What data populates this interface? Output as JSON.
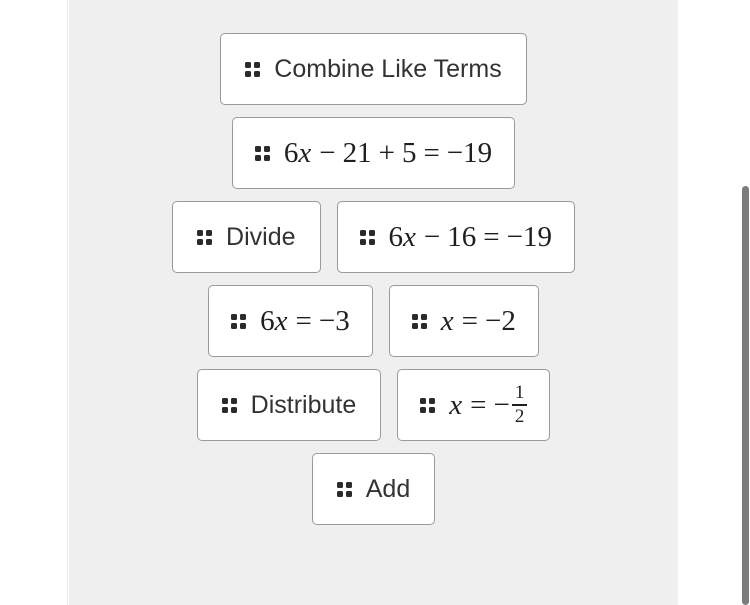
{
  "panel": {
    "background_color": "#efefef",
    "tile_background_color": "#ffffff",
    "tile_border_color": "#9a9a9a",
    "handle_icon": "drag-handle-icon"
  },
  "scrollbar": {
    "thumb_color": "#7c7c7c",
    "orientation": "vertical"
  },
  "rows": [
    {
      "tiles": [
        {
          "kind": "label",
          "text": "Combine Like Terms"
        }
      ]
    },
    {
      "tiles": [
        {
          "kind": "math",
          "text": "6x − 21 + 5 = −19"
        }
      ]
    },
    {
      "tiles": [
        {
          "kind": "label",
          "text": "Divide"
        },
        {
          "kind": "math",
          "text": "6x − 16 = −19"
        }
      ]
    },
    {
      "tiles": [
        {
          "kind": "math",
          "text": "6x = −3"
        },
        {
          "kind": "math",
          "text": "x = −2"
        }
      ]
    },
    {
      "tiles": [
        {
          "kind": "label",
          "text": "Distribute"
        },
        {
          "kind": "math",
          "text": "x = −1/2",
          "fraction": {
            "numerator": "1",
            "denominator": "2"
          }
        }
      ]
    },
    {
      "tiles": [
        {
          "kind": "label",
          "text": "Add"
        }
      ]
    }
  ],
  "tiles": {
    "combine_like_terms": "Combine Like Terms",
    "divide": "Divide",
    "distribute": "Distribute",
    "add": "Add",
    "eq_1": {
      "coef": "6",
      "var": "x",
      "op1": "−",
      "term1": "21",
      "op2": "+",
      "term2": "5",
      "eq": "=",
      "rhs": "−19"
    },
    "eq_2": {
      "coef": "6",
      "var": "x",
      "op1": "−",
      "term1": "16",
      "eq": "=",
      "rhs": "−19"
    },
    "eq_3": {
      "coef": "6",
      "var": "x",
      "eq": "=",
      "rhs": "−3"
    },
    "eq_4": {
      "var": "x",
      "eq": "=",
      "rhs": "−2"
    },
    "eq_5": {
      "var": "x",
      "eq": "=",
      "minus": "−",
      "num": "1",
      "den": "2"
    }
  }
}
